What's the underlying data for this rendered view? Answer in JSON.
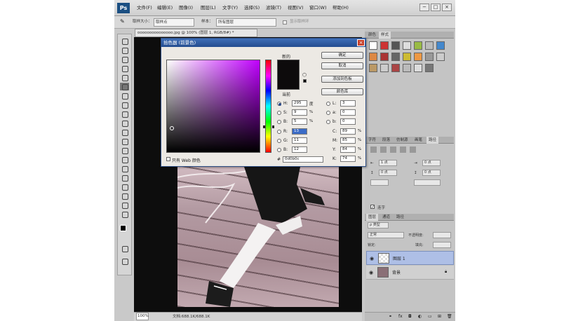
{
  "menubar": {
    "logo": "Ps",
    "items": [
      "文件(F)",
      "编辑(E)",
      "图像(I)",
      "图层(L)",
      "文字(Y)",
      "选择(S)",
      "滤镜(T)",
      "视图(V)",
      "窗口(W)",
      "帮助(H)"
    ],
    "window_controls": [
      "−",
      "□",
      "×"
    ]
  },
  "options_bar": {
    "sample_size_label": "取样大小：",
    "sample_size_value": "取样点",
    "sample_label": "样本：",
    "sample_value": "所有图层",
    "show_ring_label": "显示取样环"
  },
  "document": {
    "tab_title": "ooooooooooooooo.jpg @ 100% (图层 1, RGB/8#) *",
    "zoom": "100%",
    "doc_info": "文档:688.1K/688.1K"
  },
  "color_picker": {
    "title": "拾色器 (前景色)",
    "new_label": "新的",
    "current_label": "当前",
    "buttons": {
      "ok": "确定",
      "cancel": "取消",
      "add_swatch": "添加到色板",
      "libraries": "颜色库"
    },
    "hsb": {
      "h": "295",
      "s": "9",
      "b": "5",
      "h_unit": "度",
      "pct": "%"
    },
    "rgb": {
      "r": "13",
      "g": "11",
      "b": "12"
    },
    "lab": {
      "l": "3",
      "a": "0",
      "b": "0"
    },
    "cmyk": {
      "c": "89",
      "m": "85",
      "y": "84",
      "k": "74"
    },
    "labels": {
      "H": "H:",
      "S": "S:",
      "B": "B:",
      "R": "R:",
      "G": "G:",
      "Bb": "B:",
      "L": "L:",
      "a": "a:",
      "b": "b:",
      "C": "C:",
      "M": "M:",
      "Y": "Y:",
      "K": "K:"
    },
    "web_only_label": "只有 Web 颜色",
    "hex_label": "#",
    "hex_value": "0d0b0c",
    "color_value": "#0d0b0c"
  },
  "panels": {
    "top_tabs": [
      "颜色",
      "样式"
    ],
    "mid_tabs": [
      "字符",
      "段落",
      "仿制源",
      "画笔",
      "路径"
    ],
    "field_values": [
      "1 点",
      "0 点",
      "0 点",
      "0 点"
    ],
    "hyphen_label": "连字",
    "layers_tabs": [
      "图层",
      "通道",
      "路径"
    ],
    "kind_label": "ρ 类型",
    "blend_mode": "正常",
    "opacity_label": "不透明度:",
    "lock_label": "锁定:",
    "fill_label": "填充:",
    "layers": [
      {
        "name": "图层 1",
        "selected": true
      },
      {
        "name": "背景",
        "selected": false
      }
    ]
  }
}
